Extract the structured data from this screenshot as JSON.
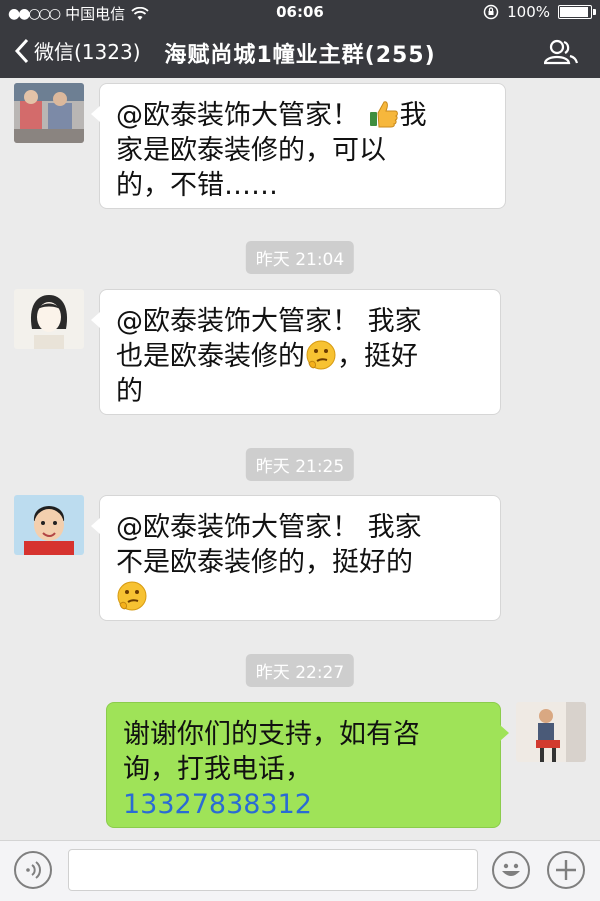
{
  "status": {
    "carrier": "中国电信",
    "time": "06:06",
    "battery": "100%",
    "battery_level": 1.0
  },
  "nav": {
    "back_label": "微信(1323)",
    "title": "海赋尚城1幢业主群(255)"
  },
  "messages": [
    {
      "direction": "in",
      "avatar_icon": "photo-avatar",
      "line1": "@欧泰装饰大管家！",
      "emoji_mid": "thumbs-up",
      "line1_end": "我",
      "line2": "家是欧泰装修的，可以",
      "line3": "的，不错……"
    },
    {
      "timestamp": "昨天 21:04"
    },
    {
      "direction": "in",
      "avatar_icon": "woman-avatar",
      "line1": "@欧泰装饰大管家！ 我家",
      "line2": "也是欧泰装修的",
      "emoji_after_line2": "thinking-face",
      "line2_end": "，挺好",
      "line3": "的"
    },
    {
      "timestamp": "昨天 21:25"
    },
    {
      "direction": "in",
      "avatar_icon": "child-avatar",
      "line1": "@欧泰装饰大管家！ 我家",
      "line2": "不是欧泰装修的，挺好的",
      "emoji_line3": "thinking-face"
    },
    {
      "timestamp": "昨天 22:27"
    },
    {
      "direction": "out",
      "avatar_icon": "man-avatar",
      "line1": "谢谢你们的支持，如有咨",
      "line2": "询，打我电话，",
      "phone": "13327838312"
    }
  ],
  "input": {
    "voice_icon": "voice-icon",
    "emoji_icon": "emoji-icon",
    "plus_icon": "plus-icon"
  },
  "colors": {
    "nav_bg": "#393a3f",
    "chat_bg": "#ebebeb",
    "out_bubble": "#9fe358",
    "link": "#2a6bd4"
  }
}
